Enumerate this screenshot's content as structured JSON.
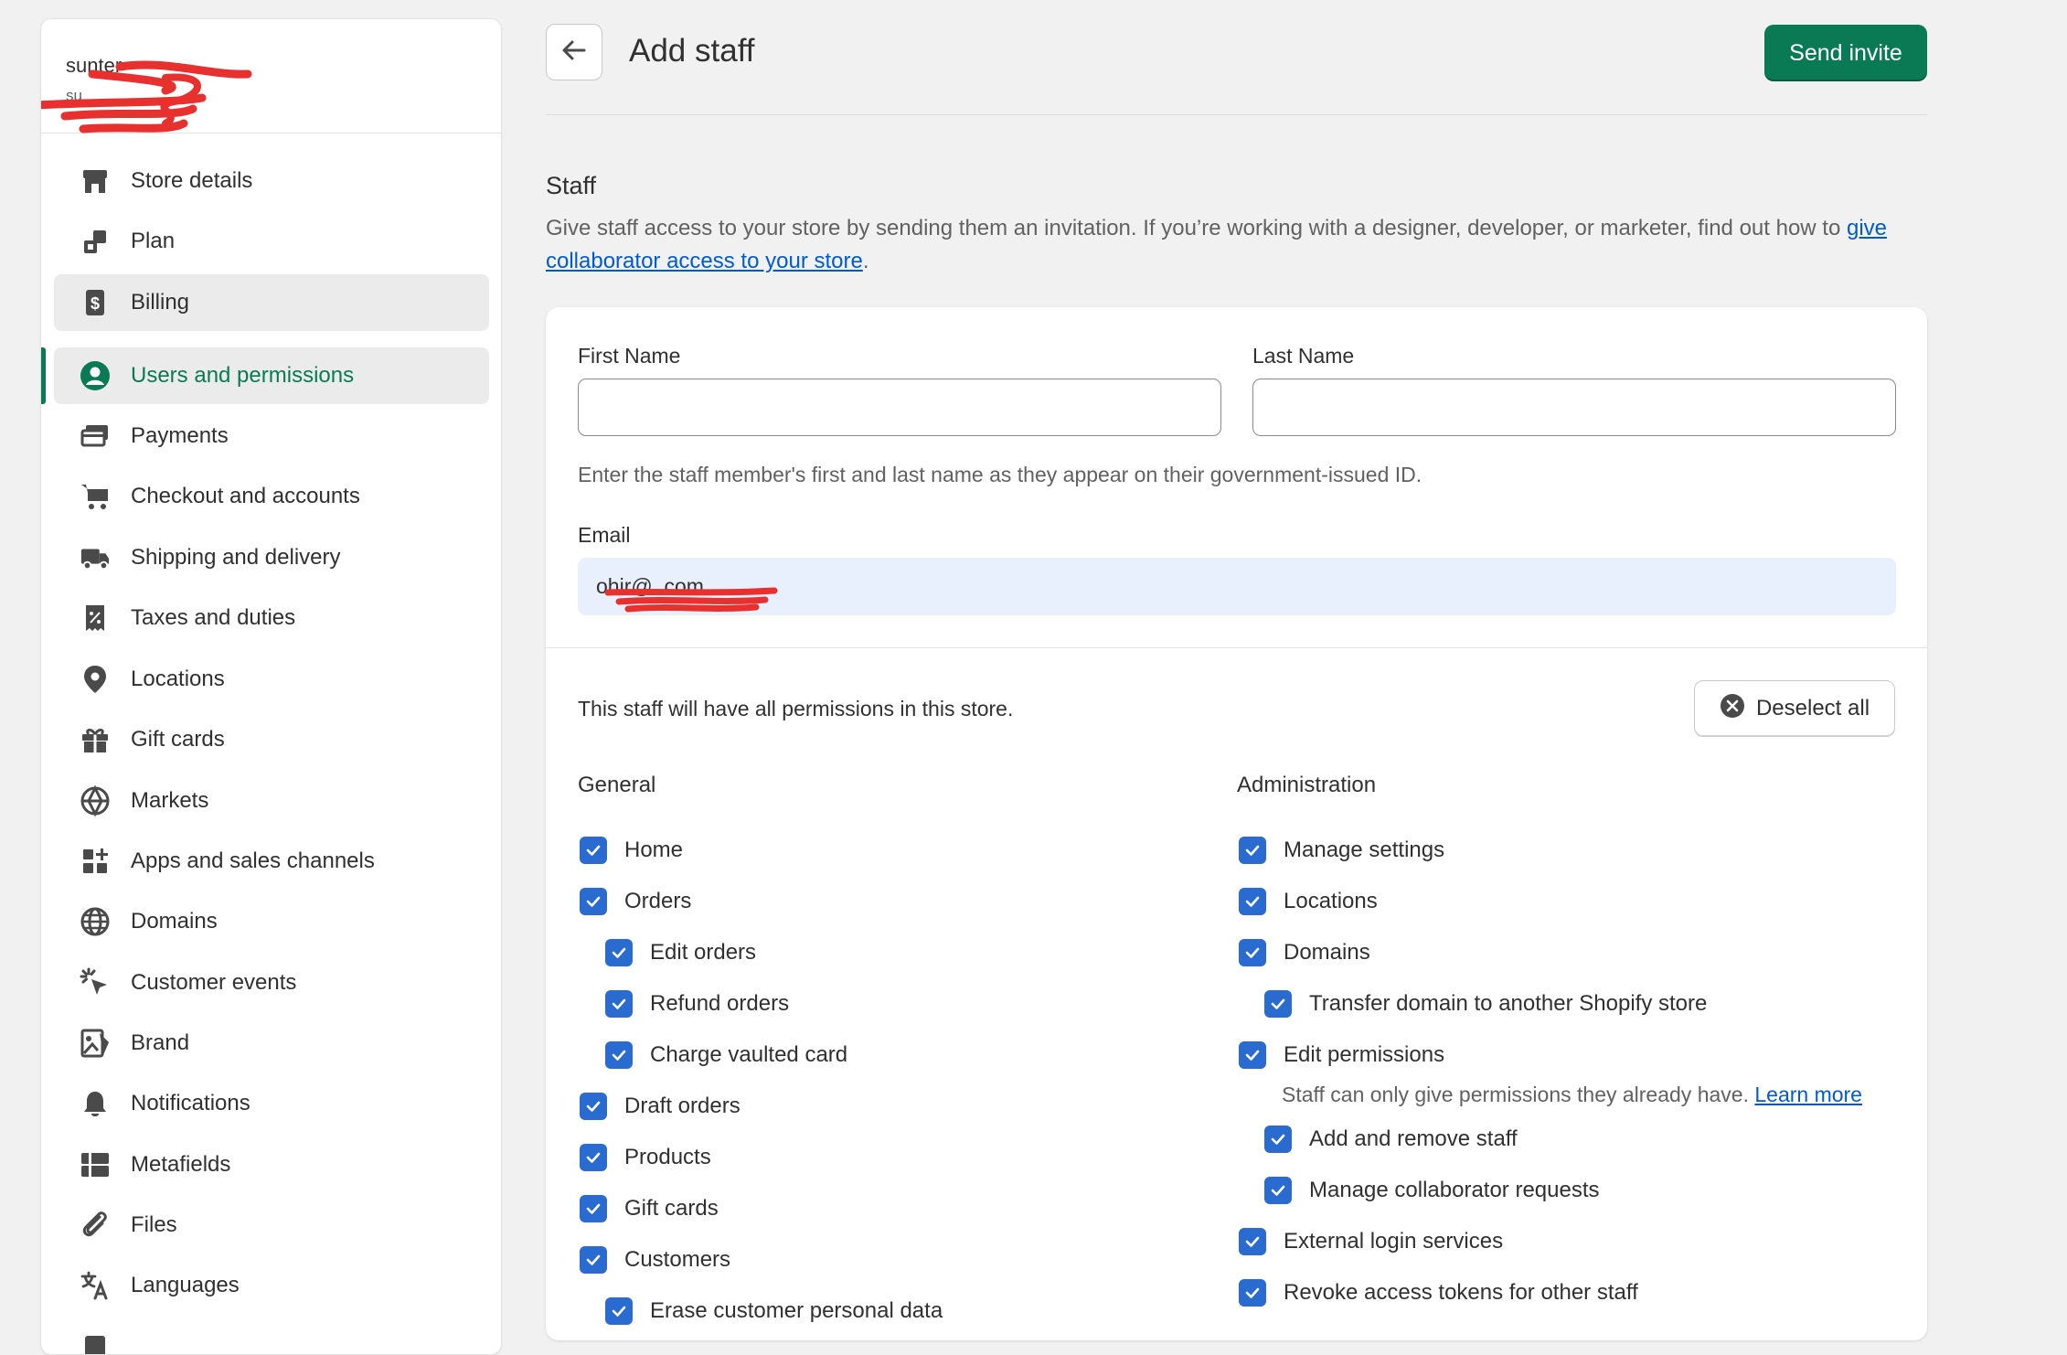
{
  "sidebar": {
    "store_name": "sunter",
    "store_sub": "su",
    "items": [
      {
        "label": "Store details",
        "icon": "store-icon"
      },
      {
        "label": "Plan",
        "icon": "plan-icon"
      },
      {
        "label": "Billing",
        "icon": "billing-icon"
      },
      {
        "label": "Users and permissions",
        "icon": "user-circle-icon"
      },
      {
        "label": "Payments",
        "icon": "payments-icon"
      },
      {
        "label": "Checkout and accounts",
        "icon": "cart-icon"
      },
      {
        "label": "Shipping and delivery",
        "icon": "truck-icon"
      },
      {
        "label": "Taxes and duties",
        "icon": "receipt-percent-icon"
      },
      {
        "label": "Locations",
        "icon": "location-pin-icon"
      },
      {
        "label": "Gift cards",
        "icon": "gift-icon"
      },
      {
        "label": "Markets",
        "icon": "globe-markets-icon"
      },
      {
        "label": "Apps and sales channels",
        "icon": "apps-icon"
      },
      {
        "label": "Domains",
        "icon": "globe-icon"
      },
      {
        "label": "Customer events",
        "icon": "cursor-click-icon"
      },
      {
        "label": "Brand",
        "icon": "brand-icon"
      },
      {
        "label": "Notifications",
        "icon": "bell-icon"
      },
      {
        "label": "Metafields",
        "icon": "metafields-icon"
      },
      {
        "label": "Files",
        "icon": "paperclip-icon"
      },
      {
        "label": "Languages",
        "icon": "translate-icon"
      }
    ],
    "active_index": 3,
    "hover_index": 2
  },
  "header": {
    "title": "Add staff",
    "send_invite": "Send invite"
  },
  "section": {
    "title": "Staff",
    "desc_text": "Give staff access to your store by sending them an invitation. If you’re working with a designer, developer, or marketer, find out how to ",
    "desc_link": "give collaborator access to your store",
    "desc_end": "."
  },
  "form": {
    "first_name_label": "First Name",
    "first_name_value": "",
    "last_name_label": "Last Name",
    "last_name_value": "",
    "name_help": "Enter the staff member's first and last name as they appear on their government-issued ID.",
    "email_label": "Email",
    "email_value": "ohir",
    "email_value_tail": "@ .com"
  },
  "permissions": {
    "note": "This staff will have all permissions in this store.",
    "deselect_all": "Deselect all",
    "general_title": "General",
    "administration_title": "Administration",
    "general": [
      {
        "label": "Home",
        "checked": true
      },
      {
        "label": "Orders",
        "checked": true
      },
      {
        "label": "Edit orders",
        "checked": true
      },
      {
        "label": "Refund orders",
        "checked": true
      },
      {
        "label": "Charge vaulted card",
        "checked": true
      },
      {
        "label": "Draft orders",
        "checked": true
      },
      {
        "label": "Products",
        "checked": true
      },
      {
        "label": "Gift cards",
        "checked": true
      },
      {
        "label": "Customers",
        "checked": true
      },
      {
        "label": "Erase customer personal data",
        "checked": true
      }
    ],
    "administration": [
      {
        "label": "Manage settings",
        "checked": true
      },
      {
        "label": "Locations",
        "checked": true
      },
      {
        "label": "Domains",
        "checked": true
      },
      {
        "label": "Transfer domain to another Shopify store",
        "checked": true
      },
      {
        "label": "Edit permissions",
        "checked": true
      },
      {
        "label": "Add and remove staff",
        "checked": true
      },
      {
        "label": "Manage collaborator requests",
        "checked": true
      },
      {
        "label": "External login services",
        "checked": true
      },
      {
        "label": "Revoke access tokens for other staff",
        "checked": true
      }
    ],
    "edit_permissions_help": "Staff can only give permissions they already have. ",
    "learn_more": "Learn more"
  },
  "colors": {
    "accent": "#0a7a55",
    "checkbox": "#2a6bd1",
    "link": "#005bd3",
    "redaction": "#e8302e"
  }
}
